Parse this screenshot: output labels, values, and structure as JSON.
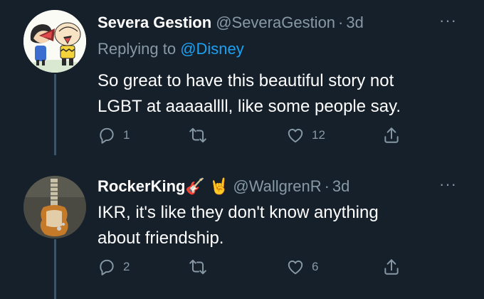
{
  "tweets": [
    {
      "display_name": "Severa Gestion",
      "handle": "@SeveraGestion",
      "dot": "·",
      "time": "3d",
      "replying_prefix": "Replying to ",
      "replying_to": "@Disney",
      "text_line1": "So great to have this beautiful story not",
      "text_line2": "LGBT at aaaaallll, like some people say.",
      "reply_count": "1",
      "retweet_count": "",
      "like_count": "12",
      "more": "···"
    },
    {
      "display_name": "RockerKing🎸 🤘",
      "handle": "@WallgrenR",
      "dot": "·",
      "time": "3d",
      "text_line1": "IKR, it's like they don't know anything",
      "text_line2": "about friendship.",
      "reply_count": "2",
      "retweet_count": "",
      "like_count": "6",
      "more": "···"
    }
  ],
  "icons": {
    "reply": "reply-icon",
    "retweet": "retweet-icon",
    "like": "heart-icon",
    "share": "share-icon",
    "more": "more-icon"
  },
  "colors": {
    "background": "#15202b",
    "text_primary": "#ffffff",
    "text_secondary": "#8899a6",
    "link": "#1da1f2",
    "thread_line": "#3d5466"
  }
}
